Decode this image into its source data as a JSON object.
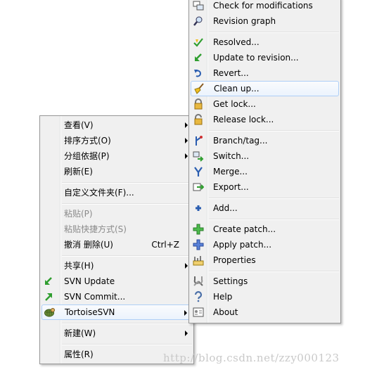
{
  "left_menu": {
    "items": [
      {
        "label": "查看(V)",
        "submenu": true
      },
      {
        "label": "排序方式(O)",
        "submenu": true
      },
      {
        "label": "分组依据(P)",
        "submenu": true
      },
      {
        "label": "刷新(E)"
      },
      {
        "label": "自定义文件夹(F)..."
      },
      {
        "label": "粘贴(P)",
        "disabled": true
      },
      {
        "label": "粘贴快捷方式(S)",
        "disabled": true
      },
      {
        "label": "撤消 删除(U)",
        "shortcut": "Ctrl+Z"
      },
      {
        "label": "共享(H)",
        "submenu": true
      },
      {
        "label": "SVN Update",
        "icon": "svn-update-icon"
      },
      {
        "label": "SVN Commit...",
        "icon": "svn-commit-icon"
      },
      {
        "label": "TortoiseSVN",
        "icon": "tortoisesvn-icon",
        "submenu": true,
        "highlighted": true
      },
      {
        "label": "新建(W)",
        "submenu": true
      },
      {
        "label": "属性(R)"
      }
    ]
  },
  "right_menu": {
    "items": [
      {
        "label": "Check for modifications",
        "icon": "check-modifications-icon"
      },
      {
        "label": "Revision graph",
        "icon": "revision-graph-icon"
      },
      {
        "label": "Resolved...",
        "icon": "resolved-icon"
      },
      {
        "label": "Update to revision...",
        "icon": "update-revision-icon"
      },
      {
        "label": "Revert...",
        "icon": "revert-icon"
      },
      {
        "label": "Clean up...",
        "icon": "cleanup-icon",
        "highlighted": true
      },
      {
        "label": "Get lock...",
        "icon": "lock-icon"
      },
      {
        "label": "Release lock...",
        "icon": "unlock-icon"
      },
      {
        "label": "Branch/tag...",
        "icon": "branch-icon"
      },
      {
        "label": "Switch...",
        "icon": "switch-icon"
      },
      {
        "label": "Merge...",
        "icon": "merge-icon"
      },
      {
        "label": "Export...",
        "icon": "export-icon"
      },
      {
        "label": "Add...",
        "icon": "add-icon"
      },
      {
        "label": "Create patch...",
        "icon": "create-patch-icon"
      },
      {
        "label": "Apply patch...",
        "icon": "apply-patch-icon"
      },
      {
        "label": "Properties",
        "icon": "properties-icon"
      },
      {
        "label": "Settings",
        "icon": "settings-icon"
      },
      {
        "label": "Help",
        "icon": "help-icon"
      },
      {
        "label": "About",
        "icon": "about-icon"
      }
    ]
  },
  "watermark": "http://blog.csdn.net/zzy000123",
  "colors": {
    "menu_bg": "#f0f0f0",
    "menu_border": "#979797",
    "highlight_border": "#aecff7",
    "disabled_text": "#8a8a8a"
  }
}
